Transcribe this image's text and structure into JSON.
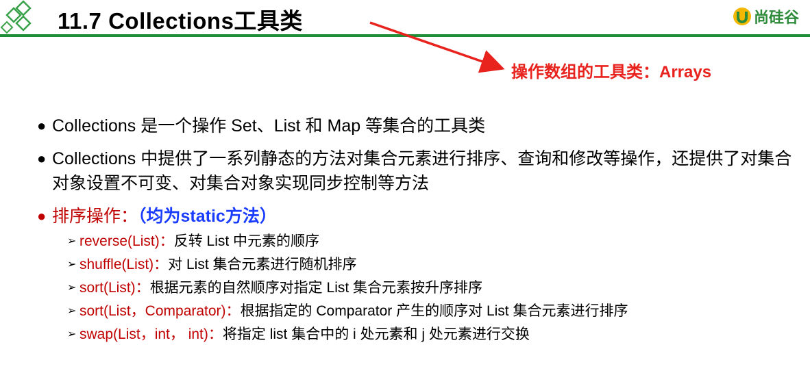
{
  "header": {
    "title": "11.7 Collections工具类",
    "brand": "尚硅谷"
  },
  "annotation": {
    "text": "操作数组的工具类：Arrays"
  },
  "bullets": [
    {
      "text": "Collections 是一个操作 Set、List 和 Map 等集合的工具类"
    },
    {
      "text": "Collections 中提供了一系列静态的方法对集合元素进行排序、查询和修改等操作，还提供了对集合对象设置不可变、对集合对象实现同步控制等方法"
    }
  ],
  "sort_section": {
    "heading": "排序操作：",
    "paren": "（均为static方法）",
    "items": [
      {
        "method": "reverse(List)：",
        "desc": "反转 List 中元素的顺序"
      },
      {
        "method": "shuffle(List)：",
        "desc": "对 List 集合元素进行随机排序"
      },
      {
        "method": "sort(List)：",
        "desc": "根据元素的自然顺序对指定 List 集合元素按升序排序"
      },
      {
        "method": "sort(List，Comparator)：",
        "desc": "根据指定的 Comparator 产生的顺序对 List 集合元素进行排序"
      },
      {
        "method": "swap(List，int， int)：",
        "desc": "将指定 list 集合中的 i 处元素和 j 处元素进行交换"
      }
    ]
  },
  "colors": {
    "accent_green": "#1f8f3a",
    "annotation_red": "#e8221d",
    "method_red": "#c00000",
    "paren_blue": "#1a3cff"
  },
  "icons": {
    "logo": "diamond-logo-icon",
    "brand": "brand-u-icon",
    "bullet": "bullet-dot-icon",
    "sub_bullet": "arrowhead-bullet-icon"
  }
}
